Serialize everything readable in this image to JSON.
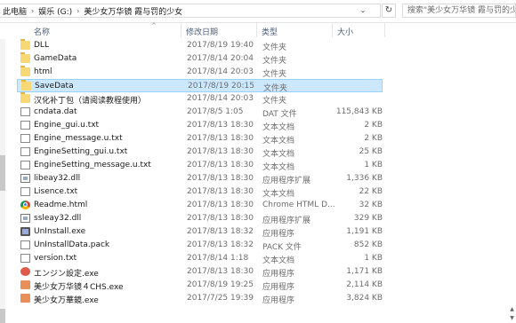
{
  "address_bar": {
    "crumbs": [
      "此电脑",
      "娱乐 (G:)",
      "美少女万华镜 霞与罚的少女"
    ],
    "search_placeholder": "搜索\"美少女万华镜 霞与罚的少女\""
  },
  "columns": {
    "name": "名称",
    "date": "修改日期",
    "type": "类型",
    "size": "大小"
  },
  "files": [
    {
      "name": "DLL",
      "date": "2017/8/19 19:40",
      "type": "文件夹",
      "size": "",
      "icon": "folder-icon"
    },
    {
      "name": "GameData",
      "date": "2017/8/14 20:04",
      "type": "文件夹",
      "size": "",
      "icon": "folder-icon"
    },
    {
      "name": "html",
      "date": "2017/8/14 20:03",
      "type": "文件夹",
      "size": "",
      "icon": "folder-icon"
    },
    {
      "name": "SaveData",
      "date": "2017/8/19 20:15",
      "type": "文件夹",
      "size": "",
      "icon": "folder-icon",
      "selected": true
    },
    {
      "name": "汉化补丁包（请阅读教程使用）",
      "date": "2017/8/14 20:03",
      "type": "文件夹",
      "size": "",
      "icon": "folder-icon"
    },
    {
      "name": "cndata.dat",
      "date": "2017/8/5 1:05",
      "type": "DAT 文件",
      "size": "115,843 KB",
      "icon": "file-icon"
    },
    {
      "name": "Engine_gui.u.txt",
      "date": "2017/8/13 18:30",
      "type": "文本文档",
      "size": "2 KB",
      "icon": "file-icon"
    },
    {
      "name": "Engine_message.u.txt",
      "date": "2017/8/13 18:30",
      "type": "文本文档",
      "size": "2 KB",
      "icon": "file-icon"
    },
    {
      "name": "EngineSetting_gui.u.txt",
      "date": "2017/8/13 18:30",
      "type": "文本文档",
      "size": "25 KB",
      "icon": "file-icon"
    },
    {
      "name": "EngineSetting_message.u.txt",
      "date": "2017/8/13 18:30",
      "type": "文本文档",
      "size": "1 KB",
      "icon": "file-icon"
    },
    {
      "name": "libeay32.dll",
      "date": "2017/8/13 18:30",
      "type": "应用程序扩展",
      "size": "1,336 KB",
      "icon": "dll-icon"
    },
    {
      "name": "Lisence.txt",
      "date": "2017/8/13 18:30",
      "type": "文本文档",
      "size": "22 KB",
      "icon": "file-icon"
    },
    {
      "name": "Readme.html",
      "date": "2017/8/13 18:30",
      "type": "Chrome HTML D...",
      "size": "32 KB",
      "icon": "chrome-icon"
    },
    {
      "name": "ssleay32.dll",
      "date": "2017/8/13 18:30",
      "type": "应用程序扩展",
      "size": "329 KB",
      "icon": "dll-icon"
    },
    {
      "name": "UnInstall.exe",
      "date": "2017/8/13 18:32",
      "type": "应用程序",
      "size": "1,191 KB",
      "icon": "exe-icon"
    },
    {
      "name": "UnInstallData.pack",
      "date": "2017/8/13 18:32",
      "type": "PACK 文件",
      "size": "852 KB",
      "icon": "file-icon"
    },
    {
      "name": "version.txt",
      "date": "2017/8/14 1:18",
      "type": "文本文档",
      "size": "1 KB",
      "icon": "file-icon"
    },
    {
      "name": "エンジン設定.exe",
      "date": "2017/8/13 18:30",
      "type": "应用程序",
      "size": "1,171 KB",
      "icon": "app-red-icon"
    },
    {
      "name": "美少女万华镜４CHS.exe",
      "date": "2017/8/19 19:25",
      "type": "应用程序",
      "size": "2,114 KB",
      "icon": "app-orange-icon"
    },
    {
      "name": "美少女万華鏡.exe",
      "date": "2017/7/25 19:39",
      "type": "应用程序",
      "size": "3,824 KB",
      "icon": "app-orange-icon"
    }
  ]
}
